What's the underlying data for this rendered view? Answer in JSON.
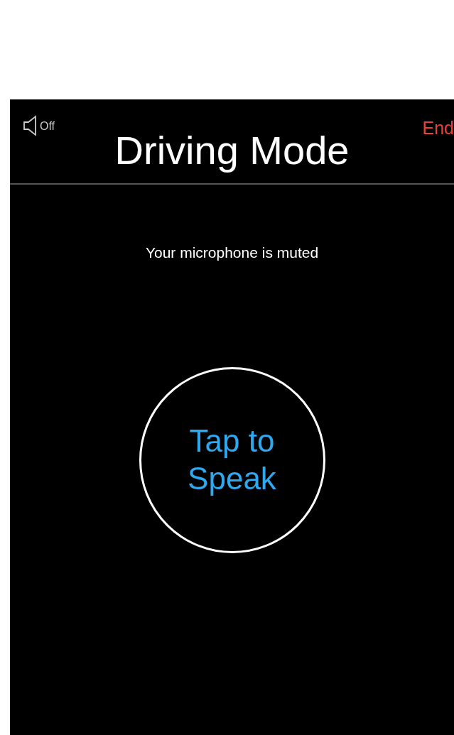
{
  "header": {
    "speaker": {
      "label": "Off"
    },
    "title": "Driving Mode",
    "end_button": "End"
  },
  "status_message": "Your microphone is muted",
  "speak_button": {
    "lines": [
      "Tap to",
      "Speak"
    ]
  }
}
